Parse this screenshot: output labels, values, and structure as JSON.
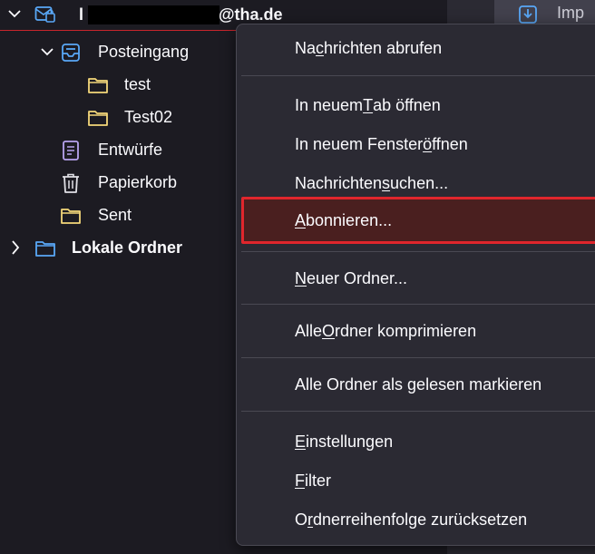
{
  "account": {
    "initial": "l",
    "suffix": "@tha.de"
  },
  "header_tab": {
    "label": "Imp"
  },
  "folders": [
    {
      "label": "Posteingang"
    },
    {
      "label": "test"
    },
    {
      "label": "Test02"
    },
    {
      "label": "Entwürfe"
    },
    {
      "label": "Papierkorb"
    },
    {
      "label": "Sent"
    },
    {
      "label": "Lokale Ordner"
    }
  ],
  "menu": {
    "items": [
      {
        "pre": "Na",
        "key": "c",
        "post": "hrichten abrufen"
      },
      {
        "pre": "In neuem ",
        "key": "T",
        "post": "ab öffnen"
      },
      {
        "pre": "In neuem Fenster ",
        "key": "ö",
        "post": "ffnen"
      },
      {
        "pre": "Nachrichten ",
        "key": "s",
        "post": "uchen..."
      },
      {
        "pre": "",
        "key": "A",
        "post": "bonnieren..."
      },
      {
        "pre": "",
        "key": "N",
        "post": "euer Ordner..."
      },
      {
        "pre": "Alle ",
        "key": "O",
        "post": "rdner komprimieren"
      },
      {
        "pre": "Alle Ordner als gelesen markieren",
        "key": "",
        "post": ""
      },
      {
        "pre": "",
        "key": "E",
        "post": "instellungen"
      },
      {
        "pre": "",
        "key": "F",
        "post": "ilter"
      },
      {
        "pre": "O",
        "key": "r",
        "post": "dnerreihenfolge zurücksetzen"
      }
    ]
  },
  "colors": {
    "pane_bg": "#1c1b22",
    "menu_bg": "#2b2a33",
    "highlight_border": "#e0262c",
    "highlight_bg": "#4a1f1f",
    "folder_icon": "#f4d77a",
    "inbox_icon": "#59a8f7",
    "draft_icon": "#b8a4f0"
  }
}
